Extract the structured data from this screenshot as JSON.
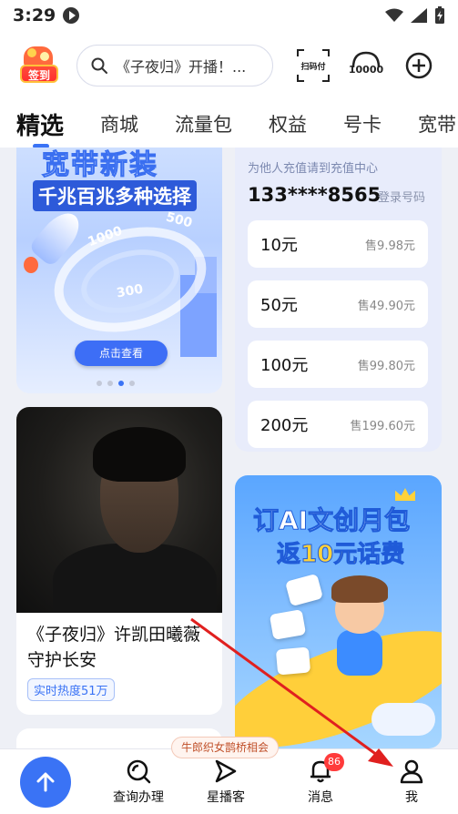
{
  "status_bar": {
    "time": "3:29"
  },
  "header": {
    "checkin_label": "签到",
    "search_placeholder": "《子夜归》开播！...",
    "scan_label": "扫码付",
    "number_label": "10000"
  },
  "tabs": [
    "精选",
    "商城",
    "流量包",
    "权益",
    "号卡",
    "宽带"
  ],
  "banner": {
    "title": "宽带新装",
    "subtitle": "千兆百兆多种选择",
    "button": "点击查看",
    "ring_labels": [
      "1000",
      "500",
      "300"
    ]
  },
  "recharge": {
    "hint": "为他人充值请到充值中心",
    "phone": "133****8565",
    "login": "登录号码",
    "items": [
      {
        "amount": "10元",
        "price": "售9.98元"
      },
      {
        "amount": "50元",
        "price": "售49.90元"
      },
      {
        "amount": "100元",
        "price": "售99.80元"
      },
      {
        "amount": "200元",
        "price": "售199.60元"
      }
    ]
  },
  "movie": {
    "title": "《子夜归》许凯田曦薇守护长安",
    "heat": "实时热度51万"
  },
  "promo": {
    "line1": "订AI文创月包",
    "line2_prefix": "返",
    "line2_highlight": "10元",
    "line2_suffix": "话费"
  },
  "bottom_nav": {
    "banner": "牛郎织女鹊桥相会",
    "items": [
      {
        "label": "查询办理"
      },
      {
        "label": "星播客"
      },
      {
        "label": "消息",
        "badge": "86"
      },
      {
        "label": "我"
      }
    ]
  },
  "colors": {
    "accent": "#3a73f5",
    "annotation": "#e0201f"
  }
}
